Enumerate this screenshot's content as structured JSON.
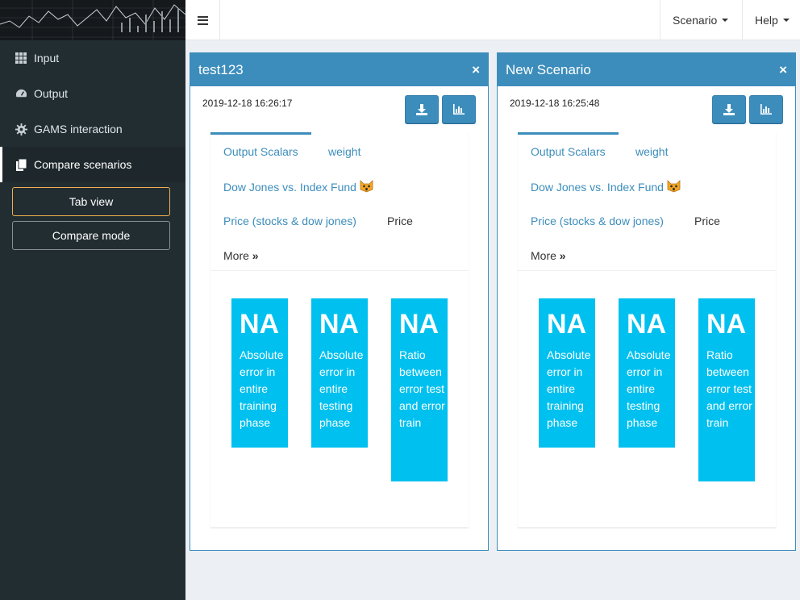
{
  "header": {
    "scenario_menu": "Scenario",
    "help_menu": "Help"
  },
  "sidebar": {
    "items": [
      {
        "label": "Input",
        "icon": "grid-icon"
      },
      {
        "label": "Output",
        "icon": "dashboard-icon"
      },
      {
        "label": "GAMS interaction",
        "icon": "gear-icon"
      },
      {
        "label": "Compare scenarios",
        "icon": "files-icon"
      }
    ],
    "tab_view_label": "Tab view",
    "compare_mode_label": "Compare mode"
  },
  "panels": [
    {
      "title": "test123",
      "close": "×",
      "date": "2019-12-18 16:26:17",
      "tabs": {
        "output_scalars": "Output Scalars",
        "weight": "weight",
        "dow_jones": "Dow Jones vs. Index Fund",
        "price_stocks": "Price (stocks & dow jones)",
        "price": "Price",
        "more": "More"
      },
      "boxes": [
        {
          "value": "NA",
          "label": "Absolute error in entire training phase"
        },
        {
          "value": "NA",
          "label": "Absolute error in entire testing phase"
        },
        {
          "value": "NA",
          "label": "Ratio between error test and error train"
        }
      ]
    },
    {
      "title": "New Scenario",
      "close": "×",
      "date": "2019-12-18 16:25:48",
      "tabs": {
        "output_scalars": "Output Scalars",
        "weight": "weight",
        "dow_jones": "Dow Jones vs. Index Fund",
        "price_stocks": "Price (stocks & dow jones)",
        "price": "Price",
        "more": "More"
      },
      "boxes": [
        {
          "value": "NA",
          "label": "Absolute error in entire training phase"
        },
        {
          "value": "NA",
          "label": "Absolute error in entire testing phase"
        },
        {
          "value": "NA",
          "label": "Ratio between error test and error train"
        }
      ]
    }
  ],
  "colors": {
    "primary": "#3c8dbc",
    "info_box": "#00c0ef",
    "sidebar": "#222d32",
    "focus_border": "#f0ad4e"
  }
}
